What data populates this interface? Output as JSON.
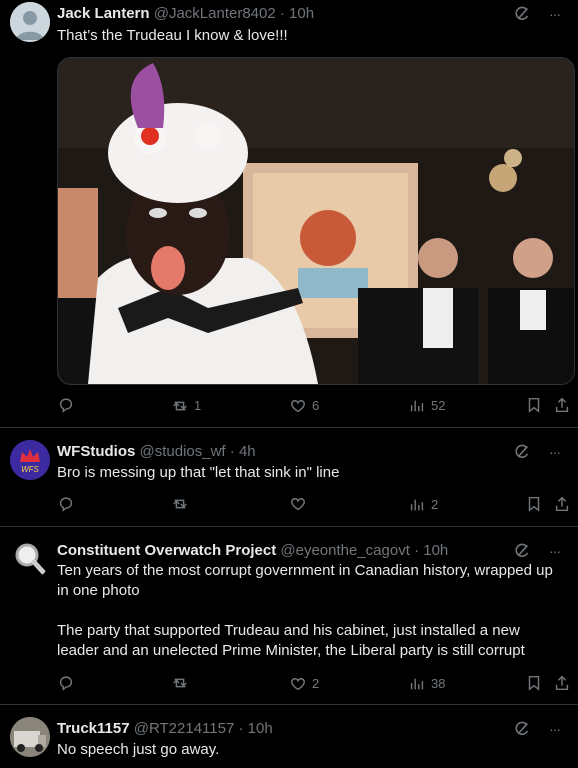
{
  "tweets": [
    {
      "name": "Jack Lantern",
      "handle": "@JackLanter8402",
      "time": "· 10h",
      "text": "That’s the Trudeau I know & love!!!",
      "retweets": "1",
      "likes": "6",
      "views": "52"
    },
    {
      "name": "WFStudios",
      "handle": "@studios_wf",
      "time": "· 4h",
      "text": "Bro is messing up that \"let that sink in\" line",
      "retweets": "",
      "likes": "",
      "views": "2"
    },
    {
      "name": "Constituent Overwatch Project",
      "handle": "@eyeonthe_cagovt",
      "time": "· 10h",
      "text": "Ten years of the most corrupt government in Canadian history, wrapped up\nin one photo\n\nThe party that supported Trudeau and his cabinet, just installed a new\nleader and an unelected Prime Minister, the Liberal party is still corrupt",
      "retweets": "",
      "likes": "2",
      "views": "38"
    },
    {
      "name": "Truck1157",
      "handle": "@RT22141157",
      "time": "· 10h",
      "text": "No speech just go away."
    }
  ],
  "more_label": "···",
  "avatar_badge": "WFS"
}
